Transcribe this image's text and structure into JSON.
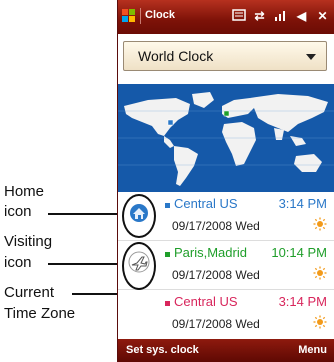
{
  "annotations": {
    "home": [
      "Home",
      "icon"
    ],
    "visiting": [
      "Visiting",
      "icon"
    ],
    "current": [
      "Current",
      "Time Zone"
    ]
  },
  "titlebar": {
    "title": "Clock"
  },
  "dropdown": {
    "value": "World Clock"
  },
  "list": [
    {
      "city": "Central US",
      "time": "3:14 PM",
      "date": "09/17/2008 Wed",
      "color": "#2a78c8",
      "icon": "home-icon"
    },
    {
      "city": "Paris,Madrid",
      "time": "10:14 PM",
      "date": "09/17/2008 Wed",
      "color": "#1f9e2a",
      "icon": "airplane-icon"
    },
    {
      "city": "Central US",
      "time": "3:14 PM",
      "date": "09/17/2008 Wed",
      "color": "#d8265c",
      "icon": ""
    }
  ],
  "bottombar": {
    "left": "Set sys. clock",
    "right": "Menu"
  },
  "colors": {
    "titlebar": "#7d1208",
    "map_ocean": "#1559a9",
    "sun": "#f29a1a"
  }
}
